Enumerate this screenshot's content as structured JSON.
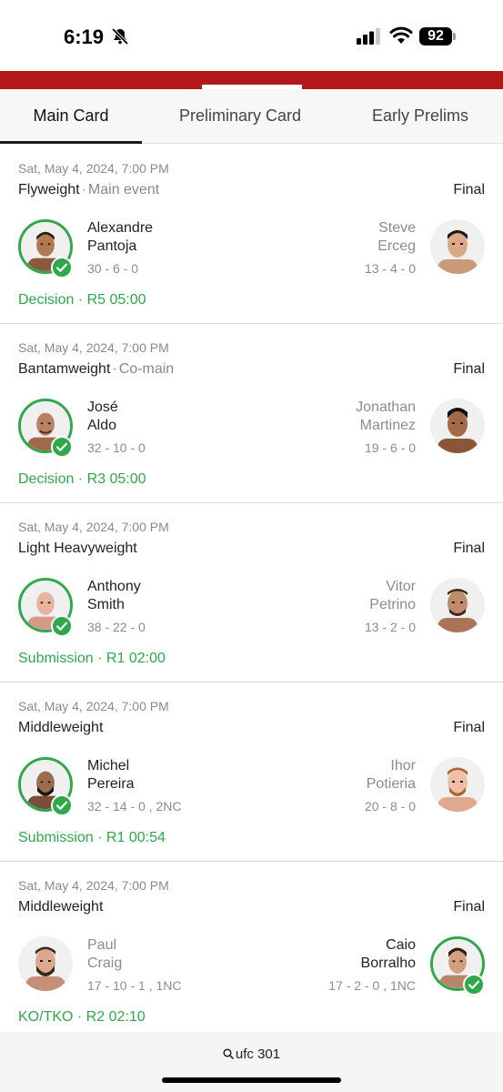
{
  "status_bar": {
    "time": "6:19",
    "battery": "92"
  },
  "tabs": [
    {
      "label": "Main Card",
      "active": true
    },
    {
      "label": "Preliminary Card",
      "active": false
    },
    {
      "label": "Early Prelims",
      "active": false
    }
  ],
  "fights": [
    {
      "date": "Sat, May 4, 2024, 7:00 PM",
      "weight_class": "Flyweight",
      "tag": "Main event",
      "status": "Final",
      "left": {
        "first": "Alexandre",
        "last": "Pantoja",
        "record": "30 - 6 - 0",
        "winner": true
      },
      "right": {
        "first": "Steve",
        "last": "Erceg",
        "record": "13 - 4 - 0",
        "winner": false
      },
      "method": "Decision · R5 05:00"
    },
    {
      "date": "Sat, May 4, 2024, 7:00 PM",
      "weight_class": "Bantamweight",
      "tag": "Co-main",
      "status": "Final",
      "left": {
        "first": "José",
        "last": "Aldo",
        "record": "32 - 10 - 0",
        "winner": true
      },
      "right": {
        "first": "Jonathan",
        "last": "Martinez",
        "record": "19 - 6 - 0",
        "winner": false
      },
      "method": "Decision · R3 05:00"
    },
    {
      "date": "Sat, May 4, 2024, 7:00 PM",
      "weight_class": "Light Heavyweight",
      "tag": "",
      "status": "Final",
      "left": {
        "first": "Anthony",
        "last": "Smith",
        "record": "38 - 22 - 0",
        "winner": true
      },
      "right": {
        "first": "Vitor",
        "last": "Petrino",
        "record": "13 - 2 - 0",
        "winner": false
      },
      "method": "Submission · R1 02:00"
    },
    {
      "date": "Sat, May 4, 2024, 7:00 PM",
      "weight_class": "Middleweight",
      "tag": "",
      "status": "Final",
      "left": {
        "first": "Michel",
        "last": "Pereira",
        "record": "32 - 14 - 0 , 2NC",
        "winner": true
      },
      "right": {
        "first": "Ihor",
        "last": "Potieria",
        "record": "20 - 8 - 0",
        "winner": false
      },
      "method": "Submission · R1 00:54"
    },
    {
      "date": "Sat, May 4, 2024, 7:00 PM",
      "weight_class": "Middleweight",
      "tag": "",
      "status": "Final",
      "left": {
        "first": "Paul",
        "last": "Craig",
        "record": "17 - 10 - 1 , 1NC",
        "winner": false
      },
      "right": {
        "first": "Caio",
        "last": "Borralho",
        "record": "17 - 2 - 0 , 1NC",
        "winner": true
      },
      "method": "KO/TKO · R2 02:10"
    }
  ],
  "search": {
    "label": "ufc 301"
  },
  "colors": {
    "brand": "#b3191b",
    "win": "#2ea84a"
  }
}
